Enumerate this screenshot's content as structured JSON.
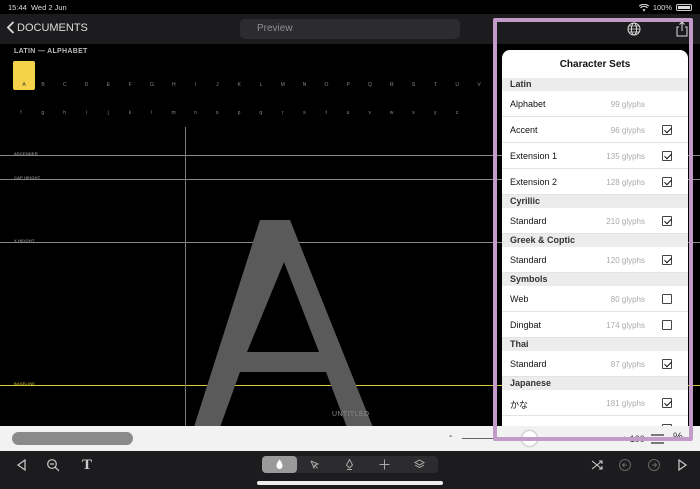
{
  "status_bar": {
    "time": "15:44",
    "date": "Wed 2 Jun",
    "battery": "100%",
    "wifi_icon": "wifi-icon",
    "battery_icon": "battery-icon"
  },
  "nav": {
    "back_label": "DOCUMENTS",
    "preview_placeholder": "Preview",
    "globe_icon": "globe-icon",
    "share_icon": "share-icon"
  },
  "canvas": {
    "section_title": "LATIN — ALPHABET",
    "selected_glyph": "A",
    "uppercase_glyphs": [
      "B",
      "C",
      "D",
      "E",
      "F",
      "G",
      "H",
      "I",
      "J",
      "K",
      "L",
      "M",
      "N",
      "O",
      "P",
      "Q",
      "R",
      "S",
      "T",
      "U",
      "V"
    ],
    "lowercase_glyphs": [
      "f",
      "g",
      "h",
      "i",
      "j",
      "k",
      "l",
      "m",
      "n",
      "o",
      "p",
      "q",
      "r",
      "s",
      "t",
      "u",
      "v",
      "w",
      "x",
      "y",
      "z"
    ],
    "guides": {
      "ascender": "ASCENDER",
      "cap_height": "CAP HEIGHT",
      "x_height": "X HEIGHT",
      "baseline": "BASELINE"
    },
    "glyph_preview": "A",
    "document_name": "UNTITLED"
  },
  "zoom": {
    "minus": "-",
    "plus": "+",
    "value": "100",
    "percent": "%",
    "level": 0.4
  },
  "popover": {
    "title": "Character Sets",
    "groups": [
      {
        "name": "Latin",
        "rows": [
          {
            "name": "Alphabet",
            "count": "99 glyphs",
            "checked": null
          },
          {
            "name": "Accent",
            "count": "96 glyphs",
            "checked": true
          },
          {
            "name": "Extension 1",
            "count": "135 glyphs",
            "checked": true
          },
          {
            "name": "Extension 2",
            "count": "128 glyphs",
            "checked": true
          }
        ]
      },
      {
        "name": "Cyrillic",
        "rows": [
          {
            "name": "Standard",
            "count": "210 glyphs",
            "checked": true
          }
        ]
      },
      {
        "name": "Greek & Coptic",
        "rows": [
          {
            "name": "Standard",
            "count": "120 glyphs",
            "checked": true
          }
        ]
      },
      {
        "name": "Symbols",
        "rows": [
          {
            "name": "Web",
            "count": "80 glyphs",
            "checked": false
          },
          {
            "name": "Dingbat",
            "count": "174 glyphs",
            "checked": false
          }
        ]
      },
      {
        "name": "Thai",
        "rows": [
          {
            "name": "Standard",
            "count": "87 glyphs",
            "checked": true
          }
        ]
      },
      {
        "name": "Japanese",
        "rows": [
          {
            "name": "かな",
            "count": "181 glyphs",
            "checked": true
          },
          {
            "name": "",
            "count": "",
            "checked": true
          }
        ]
      }
    ]
  },
  "toolbar": {
    "left_tools": [
      "play-back-icon",
      "zoom-icon",
      "text-tool-icon"
    ],
    "center_tools": [
      "brush-tool-icon",
      "pointer-tool-icon",
      "pen-tool-icon",
      "move-tool-icon",
      "layers-icon"
    ],
    "right_tools": [
      "shuffle-icon",
      "undo-icon",
      "redo-icon",
      "play-icon"
    ],
    "text_tool_label": "T"
  },
  "colors": {
    "accent": "#f4d34a",
    "baseline": "#d8c93a",
    "highlight": "#c39bc9",
    "glyph": "#5a5a5a"
  }
}
